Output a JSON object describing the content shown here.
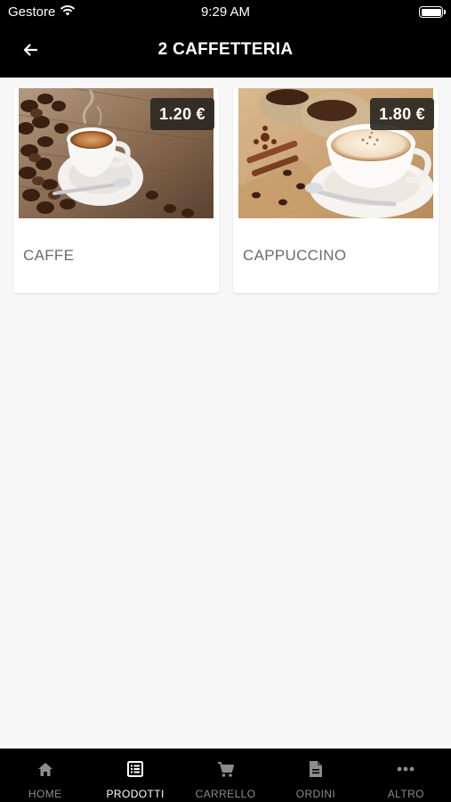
{
  "status_bar": {
    "carrier": "Gestore",
    "time": "9:29 AM"
  },
  "header": {
    "title": "2 CAFFETTERIA",
    "back_icon": "arrow-left-icon"
  },
  "products": [
    {
      "name": "CAFFE",
      "price": "1.20 €",
      "image": "espresso-cup-with-coffee-beans"
    },
    {
      "name": "CAPPUCCINO",
      "price": "1.80 €",
      "image": "cappuccino-cup-with-cinnamon-and-beans"
    }
  ],
  "tabs": [
    {
      "label": "HOME",
      "icon": "home-icon",
      "active": false
    },
    {
      "label": "PRODOTTI",
      "icon": "list-icon",
      "active": true
    },
    {
      "label": "CARRELLO",
      "icon": "cart-icon",
      "active": false
    },
    {
      "label": "ORDINI",
      "icon": "document-icon",
      "active": false
    },
    {
      "label": "ALTRO",
      "icon": "more-icon",
      "active": false
    }
  ],
  "colors": {
    "header_bg": "#000000",
    "tabbar_bg": "#000000",
    "tab_active": "#ffffff",
    "tab_inactive": "#8d8d8d",
    "product_name": "#6a6a6a",
    "price_badge": "#2d2823"
  }
}
